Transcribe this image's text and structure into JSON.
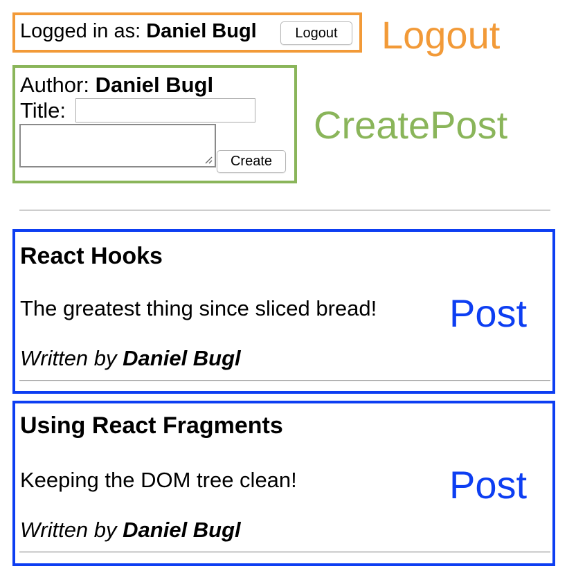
{
  "logout": {
    "label": "Logged in as:",
    "user": "Daniel Bugl",
    "button": "Logout",
    "annotation": "Logout"
  },
  "create_post": {
    "author_label": "Author:",
    "author": "Daniel Bugl",
    "title_label": "Title:",
    "title_value": "",
    "content_value": "",
    "button": "Create",
    "annotation": "CreatePost"
  },
  "posts": [
    {
      "title": "React Hooks",
      "content": "The greatest thing since sliced bread!",
      "written_by": "Written by",
      "author": "Daniel Bugl",
      "annotation": "Post"
    },
    {
      "title": "Using React Fragments",
      "content": "Keeping the DOM tree clean!",
      "written_by": "Written by",
      "author": "Daniel Bugl",
      "annotation": "Post"
    }
  ],
  "colors": {
    "logout": "#f29a38",
    "create_post": "#8ab55a",
    "post": "#0d3ef2"
  }
}
